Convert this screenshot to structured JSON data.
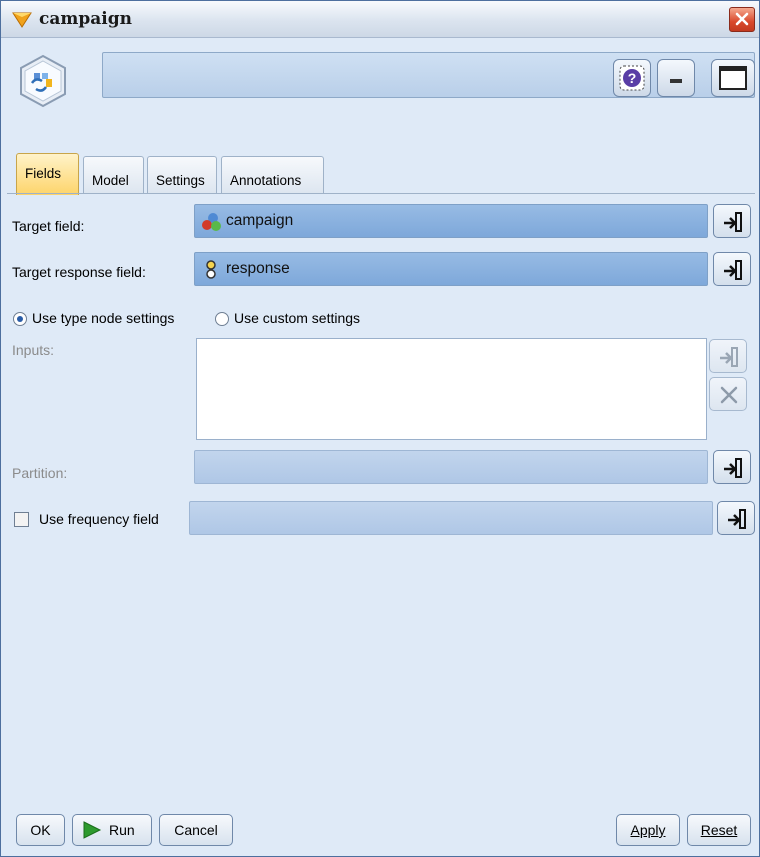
{
  "window": {
    "title": "campaign",
    "icon": "diamond-node-icon",
    "close_icon": "close-icon"
  },
  "header": {
    "node_icon": "modeling-node-icon",
    "help_icon": "help-icon",
    "minimize_icon": "minimize-icon",
    "maximize_icon": "maximize-icon"
  },
  "tabs": [
    {
      "label": "Fields",
      "active": true
    },
    {
      "label": "Model",
      "active": false
    },
    {
      "label": "Settings",
      "active": false
    },
    {
      "label": "Annotations",
      "active": false
    }
  ],
  "fields": {
    "target_field": {
      "label": "Target field:",
      "value": "campaign",
      "icon": "set-field-icon"
    },
    "target_response_field": {
      "label": "Target response field:",
      "value": "response",
      "icon": "flag-field-icon"
    },
    "radio_type_node": {
      "label": "Use type node settings",
      "selected": true
    },
    "radio_custom": {
      "label": "Use custom settings",
      "selected": false
    },
    "inputs": {
      "label": "Inputs:",
      "items": []
    },
    "partition": {
      "label": "Partition:",
      "value": ""
    },
    "frequency": {
      "label": "Use frequency field",
      "checked": false,
      "value": ""
    }
  },
  "buttons": {
    "ok": "OK",
    "run": "Run",
    "cancel": "Cancel",
    "apply": "Apply",
    "reset": "Reset"
  },
  "colors": {
    "accent": "#7ea8da",
    "active_tab": "#fdd46a",
    "panel_bg": "#dfeaf7",
    "run_green": "#2e9a2e"
  }
}
